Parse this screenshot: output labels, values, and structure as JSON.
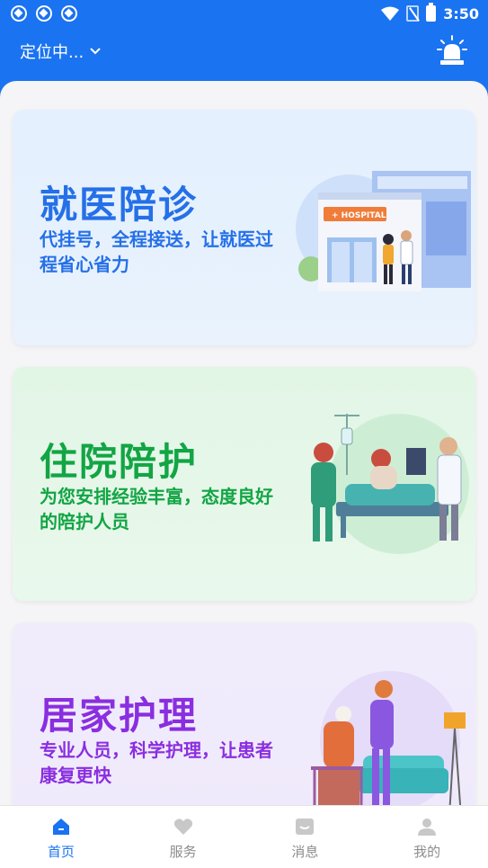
{
  "status_bar": {
    "time": "3:50",
    "notification_icons": [
      "notification-icon",
      "notification-icon",
      "notification-icon"
    ]
  },
  "header": {
    "location_text": "定位中...",
    "alarm_icon": "alarm-siren-icon"
  },
  "cards": [
    {
      "title": "就医陪诊",
      "desc": "代挂号，全程接送，让就医过程省心省力",
      "color": "#2570e8",
      "illustration": "hospital-illustration"
    },
    {
      "title": "住院陪护",
      "desc": "为您安排经验丰富，态度良好的陪护人员",
      "color": "#12a544",
      "illustration": "inpatient-care-illustration"
    },
    {
      "title": "居家护理",
      "desc": "专业人员，科学护理，让患者康复更快",
      "color": "#8a2ee0",
      "illustration": "home-care-illustration"
    }
  ],
  "tabbar": {
    "items": [
      {
        "label": "首页",
        "icon": "home-icon",
        "active": true
      },
      {
        "label": "服务",
        "icon": "heart-icon",
        "active": false
      },
      {
        "label": "消息",
        "icon": "message-icon",
        "active": false
      },
      {
        "label": "我的",
        "icon": "user-icon",
        "active": false
      }
    ],
    "active_color": "#1a73f0"
  }
}
